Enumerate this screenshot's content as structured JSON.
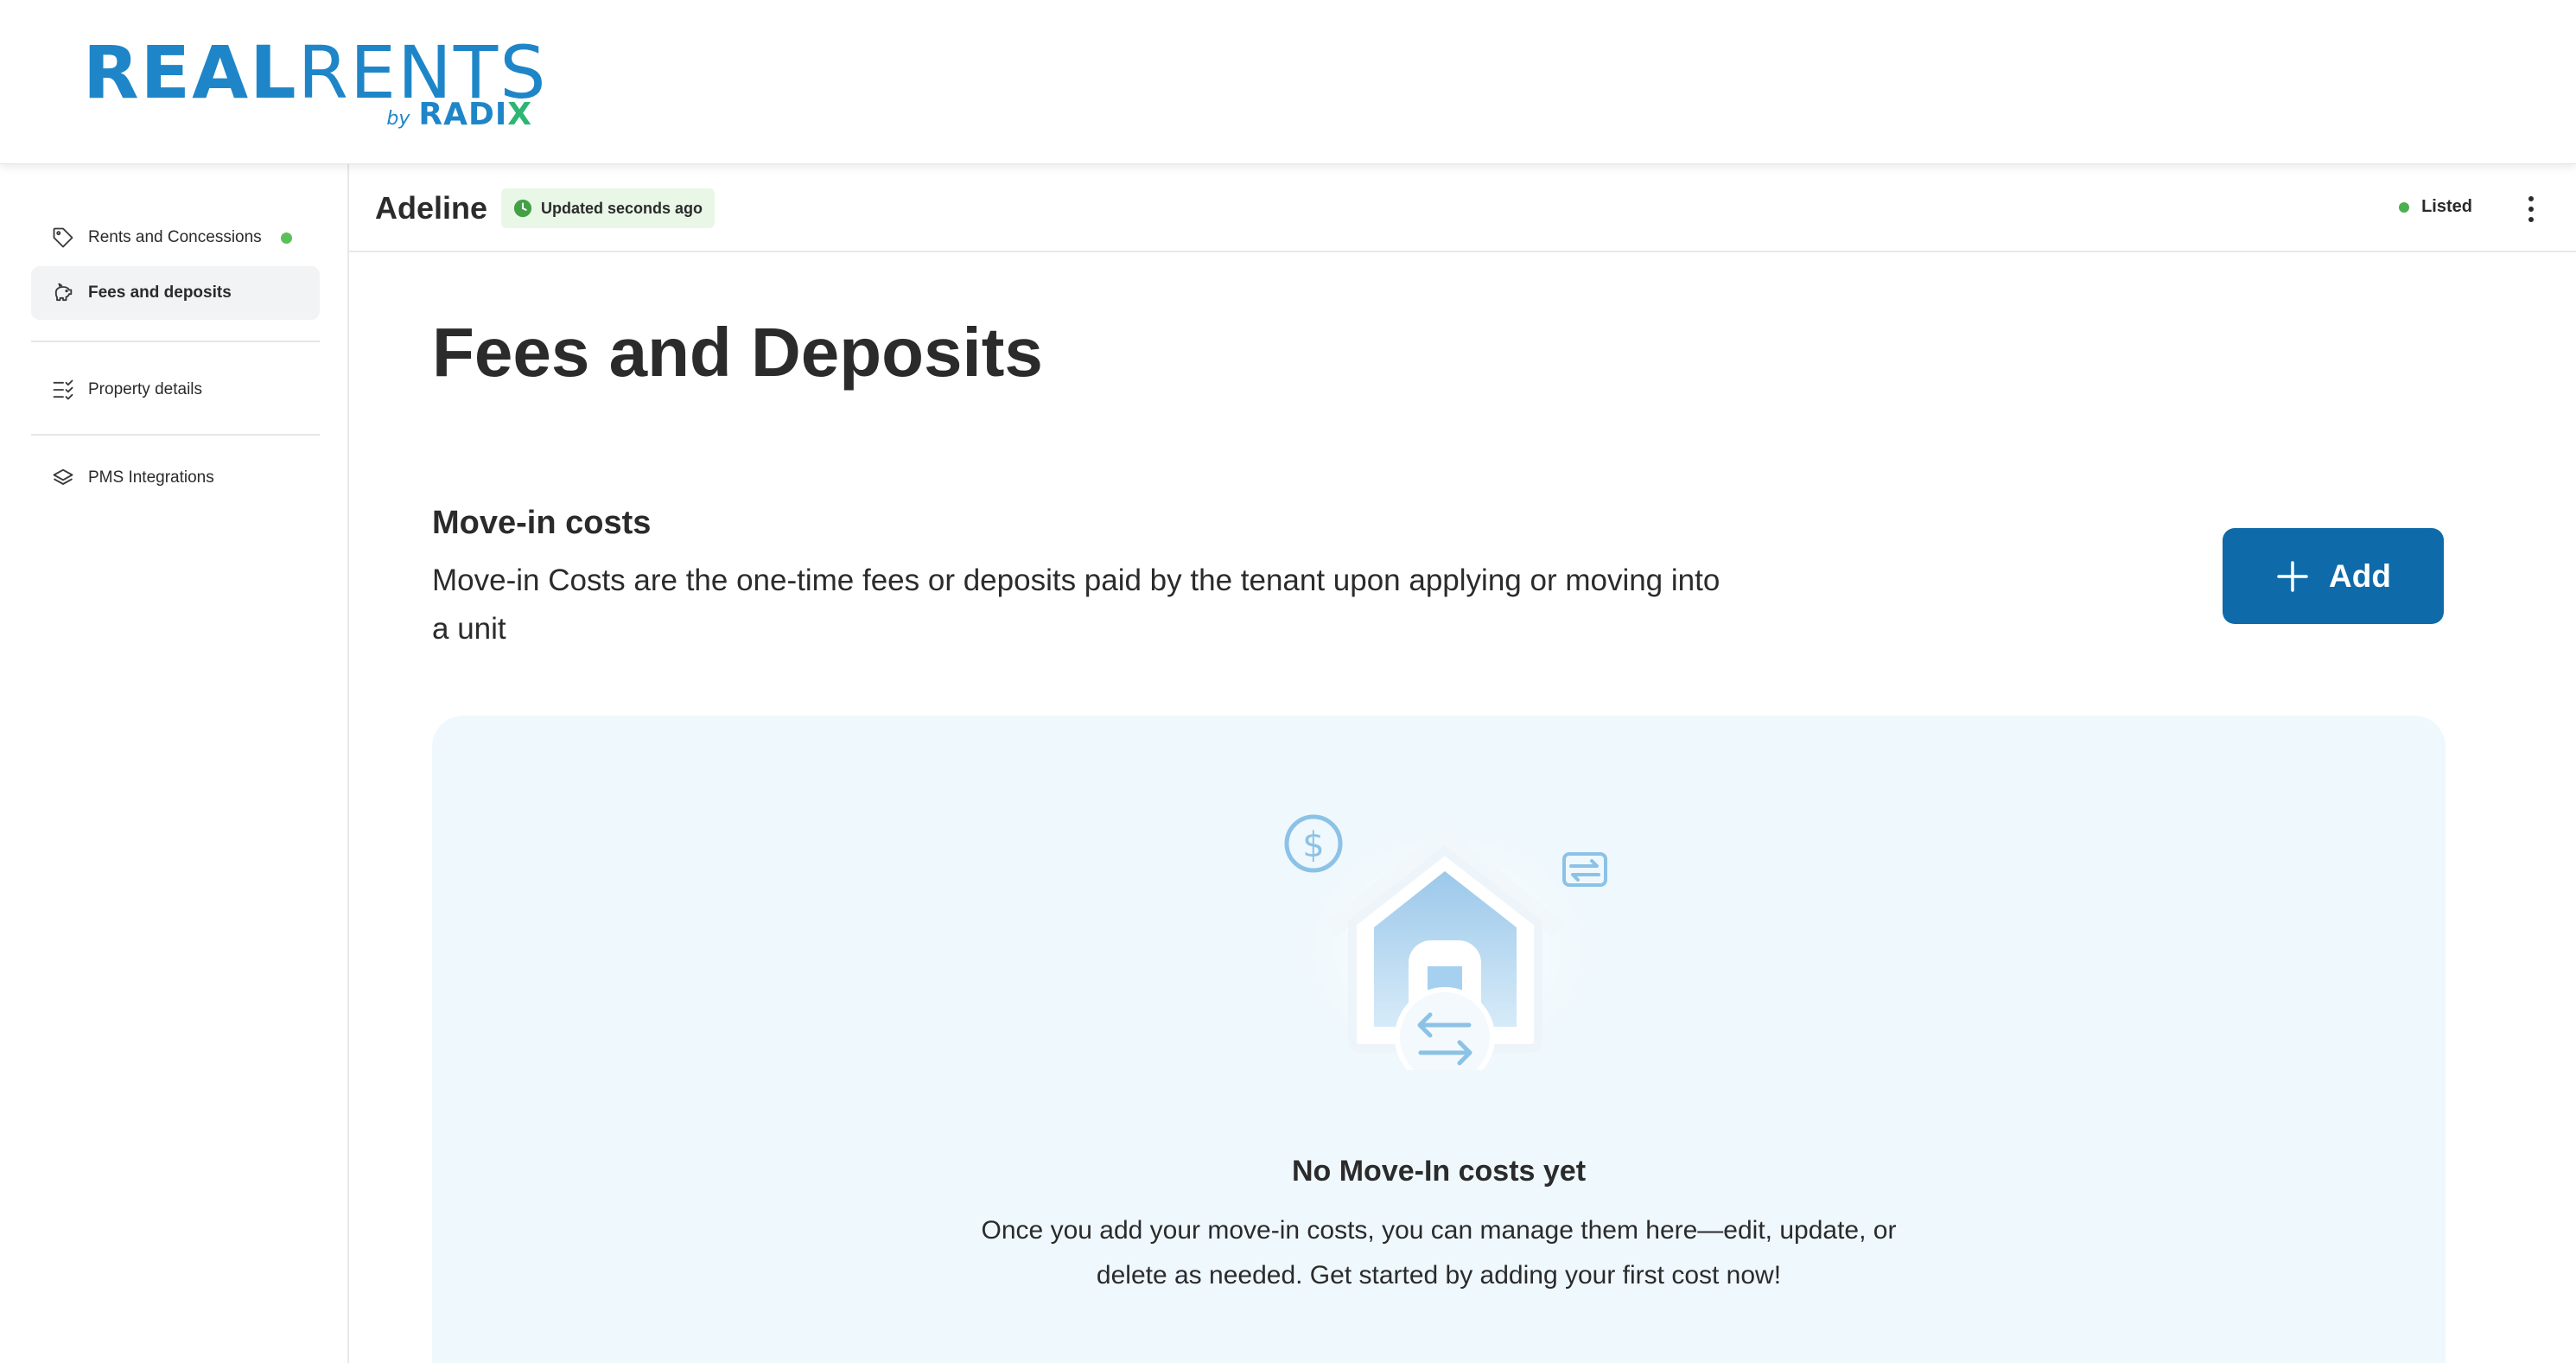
{
  "brand": {
    "logo_real": "REAL",
    "logo_rents": "RENTS",
    "logo_by": "by",
    "logo_radix": "RADI",
    "logo_radix_x": "X"
  },
  "colors": {
    "brand_blue": "#1e86c8",
    "brand_green": "#2bb673",
    "button_blue": "#0e6aa8",
    "status_green": "#4caf50",
    "empty_bg": "#eff8fd"
  },
  "sidebar": {
    "items": [
      {
        "label": "Rents and Concessions",
        "icon": "tag-icon",
        "status_dot": true
      },
      {
        "label": "Fees and deposits",
        "icon": "piggy-bank-icon",
        "active": true
      },
      {
        "label": "Property details",
        "icon": "checklist-icon"
      },
      {
        "label": "PMS Integrations",
        "icon": "layers-icon"
      }
    ]
  },
  "header": {
    "property_name": "Adeline",
    "updated_badge": "Updated seconds ago",
    "status": "Listed"
  },
  "main": {
    "title": "Fees and Deposits",
    "section_title": "Move-in costs",
    "section_description": "Move-in Costs are the one-time fees or deposits paid by the tenant upon applying or moving into a unit",
    "add_button_label": "Add",
    "empty_state": {
      "title": "No Move-In costs yet",
      "text": "Once you add your move-in costs, you can manage them here—edit, update, or delete as needed. Get started by adding your first cost now!"
    }
  }
}
